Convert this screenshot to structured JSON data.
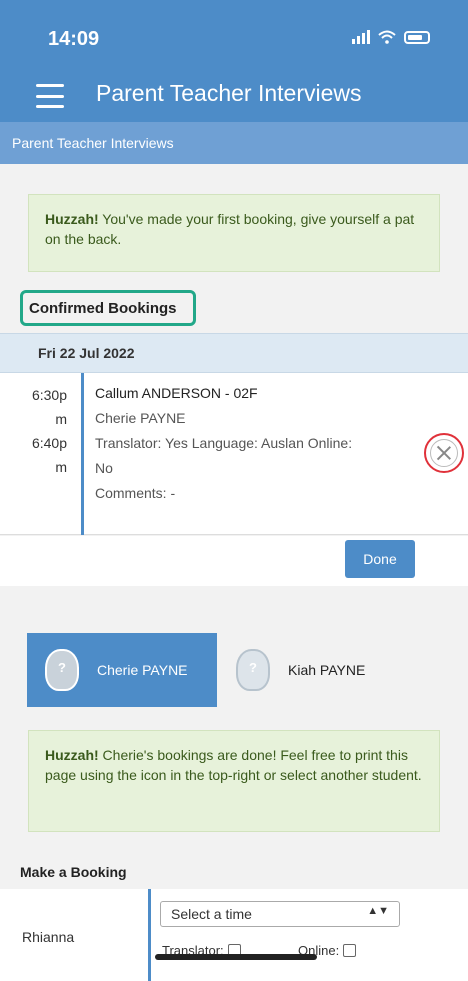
{
  "status_bar": {
    "time": "14:09"
  },
  "header": {
    "title": "Parent Teacher Interviews"
  },
  "subheader": {
    "title": "Parent Teacher Interviews"
  },
  "alert_first_booking": {
    "strong": "Huzzah!",
    "text": " You've made your first booking, give yourself a pat on the back."
  },
  "confirmed": {
    "title": "Confirmed Bookings",
    "date": "Fri 22 Jul 2022",
    "booking": {
      "start_a": "6:30p",
      "start_b": "m",
      "end_a": "6:40p",
      "end_b": "m",
      "teacher": "Callum ANDERSON - 02F",
      "student": "Cherie PAYNE",
      "details": "Translator: Yes   Language: Auslan   Online:",
      "online_value": "No",
      "comments": "Comments: -"
    },
    "done_label": "Done"
  },
  "students": [
    {
      "name": "Cherie PAYNE",
      "selected": true
    },
    {
      "name": "Kiah PAYNE",
      "selected": false
    }
  ],
  "alert_done": {
    "strong": "Huzzah!",
    "text": " Cherie's bookings are done! Feel free to print this page using the icon in the top-right or select another student."
  },
  "make_booking": {
    "title": "Make a Booking",
    "teacher": "Rhianna",
    "select_placeholder": "Select a time",
    "translator_label": "Translator:",
    "online_label": "Online:"
  },
  "colors": {
    "primary": "#4d8cc8",
    "alert_bg": "#e7f2da",
    "highlight": "#22a889",
    "cancel_ring": "#e0313a"
  }
}
